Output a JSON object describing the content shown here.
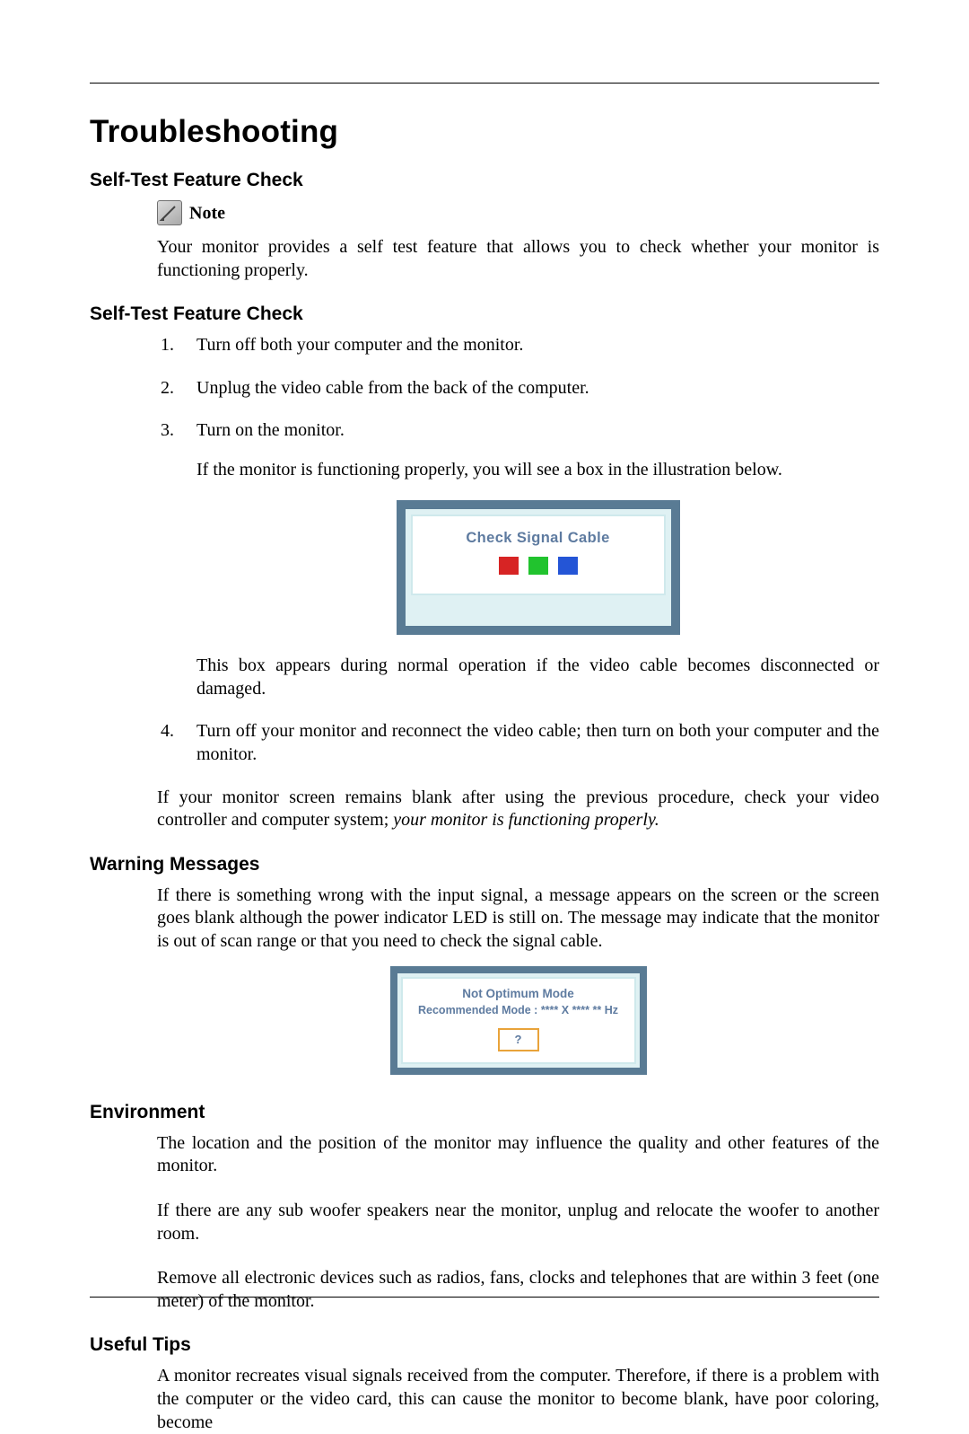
{
  "title": "Troubleshooting",
  "s1": {
    "heading": "Self-Test Feature Check",
    "note_label": "Note",
    "para": "Your monitor provides a self test feature that allows you to check whether your monitor is functioning properly."
  },
  "s2": {
    "heading": "Self-Test Feature Check",
    "steps": [
      "Turn off both your computer and the monitor.",
      "Unplug the video cable from the back of the computer.",
      "Turn on the monitor.",
      "Turn off your monitor and reconnect the video cable; then turn on both your computer and the monitor."
    ],
    "step3_sub1": "If the monitor is functioning properly, you will see a box in the illustration below.",
    "ill1_title": "Check Signal Cable",
    "step3_sub2": "This box appears during normal operation if the video cable becomes disconnected or damaged.",
    "closing_a": "If your monitor screen remains blank after using the previous procedure, check your video controller and computer system; ",
    "closing_b": "your monitor is functioning properly."
  },
  "s3": {
    "heading": "Warning Messages",
    "para": "If there is something wrong with the input signal, a message appears on the screen or the screen goes blank although the power indicator LED is still on. The message may indicate that the monitor is out of scan range or that you need to check the signal cable.",
    "ill2_line1": "Not Optimum Mode",
    "ill2_line2": "Recommended Mode : **** X **** ** Hz",
    "ill2_box": "?"
  },
  "s4": {
    "heading": "Environment",
    "p1": "The location and the position of the monitor may influence the quality and other features of the monitor.",
    "p2": "If there are any sub woofer speakers near the monitor, unplug and relocate the woofer to another room.",
    "p3": "Remove all electronic devices such as radios, fans, clocks and telephones that are within 3 feet (one meter) of the monitor."
  },
  "s5": {
    "heading": "Useful Tips",
    "p1": "A monitor recreates visual signals received from the computer. Therefore, if there is a problem with the computer or the video card, this can cause the monitor to become blank, have poor coloring, become"
  }
}
